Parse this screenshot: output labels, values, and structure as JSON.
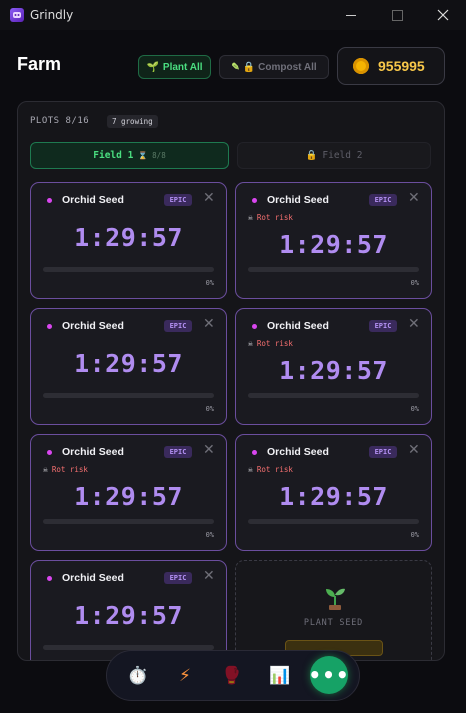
{
  "window": {
    "title": "Grindly"
  },
  "header": {
    "title": "Farm",
    "plant_all": "Plant All",
    "compost_all": "Compost All",
    "coins": "955995"
  },
  "plots": {
    "label": "PLOTS 8/16",
    "growing": "7 growing"
  },
  "tabs": [
    {
      "label": "Field 1",
      "sub": "8/8",
      "active": true
    },
    {
      "label": "Field 2",
      "locked": true
    }
  ],
  "cards": [
    {
      "seed": "Orchid Seed",
      "rarity": "EPIC",
      "rot": "",
      "timer": "1:29:57",
      "progress": "0%"
    },
    {
      "seed": "Orchid Seed",
      "rarity": "EPIC",
      "rot": "Rot risk",
      "timer": "1:29:57",
      "progress": "0%"
    },
    {
      "seed": "Orchid Seed",
      "rarity": "EPIC",
      "rot": "",
      "timer": "1:29:57",
      "progress": "0%"
    },
    {
      "seed": "Orchid Seed",
      "rarity": "EPIC",
      "rot": "Rot risk",
      "timer": "1:29:57",
      "progress": "0%"
    },
    {
      "seed": "Orchid Seed",
      "rarity": "EPIC",
      "rot": "Rot risk",
      "timer": "1:29:57",
      "progress": "0%"
    },
    {
      "seed": "Orchid Seed",
      "rarity": "EPIC",
      "rot": "Rot risk",
      "timer": "1:29:57",
      "progress": "0%"
    },
    {
      "seed": "Orchid Seed",
      "rarity": "EPIC",
      "rot": "",
      "timer": "1:29:57"
    }
  ],
  "plant_slot": {
    "label": "PLANT SEED"
  },
  "dock": {
    "icons": [
      "stopwatch-icon",
      "lightning-icon",
      "boxing-gloves-icon",
      "bar-chart-icon",
      "more-icon"
    ],
    "more_label": "•••"
  },
  "colors": {
    "accent_green": "#4ade80",
    "epic_purple": "#b08cf0",
    "rot_red": "#f87171",
    "coin_gold": "#f8c84a"
  }
}
